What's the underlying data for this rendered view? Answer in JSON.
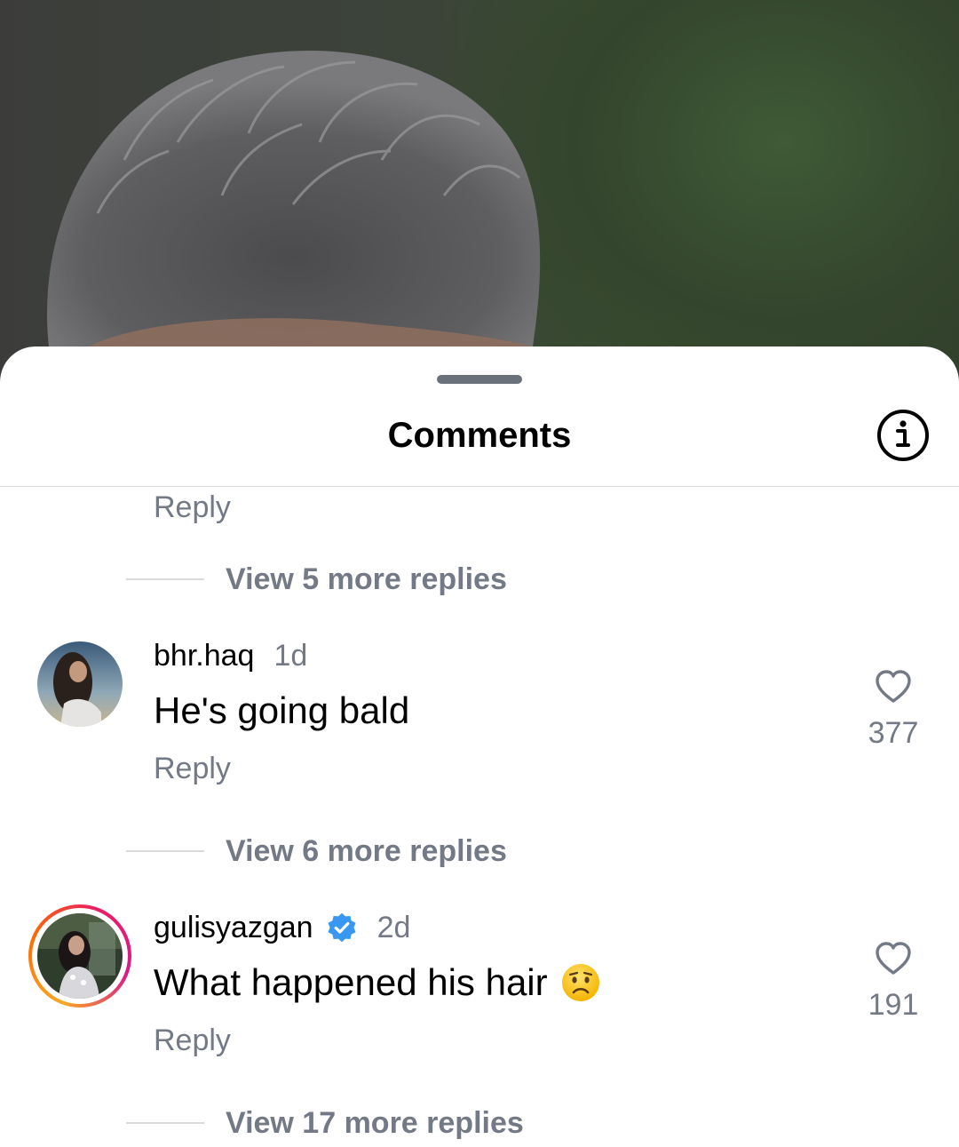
{
  "sheet": {
    "title": "Comments"
  },
  "thread_top": {
    "reply_label": "Reply",
    "view_more": "View 5 more replies"
  },
  "comments": [
    {
      "username": "bhr.haq",
      "time": "1d",
      "text": "He's going bald",
      "likes": "377",
      "reply_label": "Reply",
      "view_more": "View 6 more replies",
      "verified": false
    },
    {
      "username": "gulisyazgan",
      "time": "2d",
      "text": "What happened his hair",
      "emoji": "worried-face",
      "likes": "191",
      "reply_label": "Reply",
      "view_more": "View 17 more replies",
      "verified": true
    }
  ],
  "colors": {
    "verified_badge": "#3897f0",
    "muted_text": "#737a85"
  }
}
